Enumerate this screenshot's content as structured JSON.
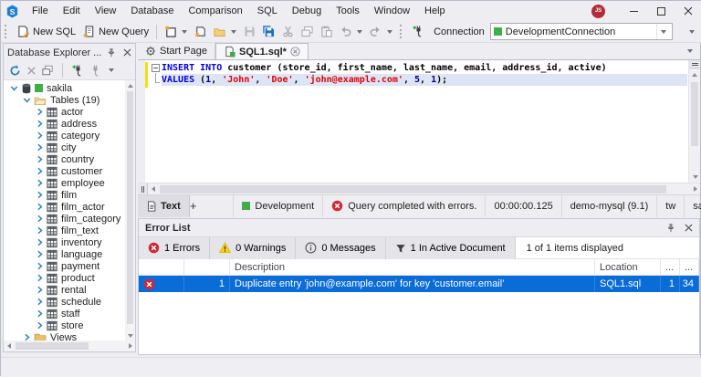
{
  "colors": {
    "accent": "#0a6cd6",
    "chrome": "#eeeef2",
    "env_green": "#3fae49",
    "error_red": "#ce2b37",
    "warning_yellow": "#fbd20b",
    "keyword_blue": "#0000e0",
    "string_red": "#e00000",
    "number_navy": "#000090",
    "modified_line_yellow": "#f2df0e"
  },
  "titlebar": {
    "menu": [
      "File",
      "Edit",
      "View",
      "Database",
      "Comparison",
      "SQL",
      "Debug",
      "Tools",
      "Window",
      "Help"
    ],
    "avatar_initials": "JS"
  },
  "toolbar": {
    "new_sql_label": "New SQL",
    "new_query_label": "New Query",
    "connection_label": "Connection",
    "connection_value": "DevelopmentConnection"
  },
  "explorer": {
    "title": "Database Explorer ...",
    "tree": [
      {
        "label": "sakila",
        "icon": "db",
        "status": "green-sq",
        "chevron": "expanded",
        "level": 0
      },
      {
        "label": "Tables (19)",
        "icon": "folder-open",
        "chevron": "expanded",
        "level": 1
      },
      {
        "label": "actor",
        "icon": "table",
        "chevron": "collapsed",
        "level": 2
      },
      {
        "label": "address",
        "icon": "table",
        "chevron": "collapsed",
        "level": 2
      },
      {
        "label": "category",
        "icon": "table",
        "chevron": "collapsed",
        "level": 2
      },
      {
        "label": "city",
        "icon": "table",
        "chevron": "collapsed",
        "level": 2
      },
      {
        "label": "country",
        "icon": "table",
        "chevron": "collapsed",
        "level": 2
      },
      {
        "label": "customer",
        "icon": "table",
        "chevron": "collapsed",
        "level": 2
      },
      {
        "label": "employee",
        "icon": "table",
        "chevron": "collapsed",
        "level": 2
      },
      {
        "label": "film",
        "icon": "table",
        "chevron": "collapsed",
        "level": 2
      },
      {
        "label": "film_actor",
        "icon": "table",
        "chevron": "collapsed",
        "level": 2
      },
      {
        "label": "film_category",
        "icon": "table",
        "chevron": "collapsed",
        "level": 2
      },
      {
        "label": "film_text",
        "icon": "table",
        "chevron": "collapsed",
        "level": 2
      },
      {
        "label": "inventory",
        "icon": "table",
        "chevron": "collapsed",
        "level": 2
      },
      {
        "label": "language",
        "icon": "table",
        "chevron": "collapsed",
        "level": 2
      },
      {
        "label": "payment",
        "icon": "table",
        "chevron": "collapsed",
        "level": 2
      },
      {
        "label": "product",
        "icon": "table",
        "chevron": "collapsed",
        "level": 2
      },
      {
        "label": "rental",
        "icon": "table",
        "chevron": "collapsed",
        "level": 2
      },
      {
        "label": "schedule",
        "icon": "table",
        "chevron": "collapsed",
        "level": 2
      },
      {
        "label": "staff",
        "icon": "table",
        "chevron": "collapsed",
        "level": 2
      },
      {
        "label": "store",
        "icon": "table",
        "chevron": "collapsed",
        "level": 2
      },
      {
        "label": "Views",
        "icon": "folder-closed",
        "chevron": "collapsed",
        "level": 1
      }
    ]
  },
  "tabs": [
    {
      "label": "Start Page",
      "icon": "gear",
      "active": false
    },
    {
      "label": "SQL1.sql*",
      "icon": "sql-doc",
      "active": true
    }
  ],
  "editor": {
    "lines": [
      {
        "highlight": false,
        "tokens": [
          {
            "t": "INSERT INTO",
            "c": "kw"
          },
          {
            "t": " customer (store_id, first_name, last_name, email, address_id, active)",
            "c": "pl"
          }
        ]
      },
      {
        "highlight": true,
        "tokens": [
          {
            "t": "VALUES",
            "c": "kw"
          },
          {
            "t": " (",
            "c": "pl"
          },
          {
            "t": "1",
            "c": "num"
          },
          {
            "t": ", ",
            "c": "pl"
          },
          {
            "t": "'John'",
            "c": "str"
          },
          {
            "t": ", ",
            "c": "pl"
          },
          {
            "t": "'Doe'",
            "c": "str"
          },
          {
            "t": ", ",
            "c": "pl"
          },
          {
            "t": "'john@example.com'",
            "c": "str"
          },
          {
            "t": ", ",
            "c": "pl"
          },
          {
            "t": "5",
            "c": "num"
          },
          {
            "t": ", ",
            "c": "pl"
          },
          {
            "t": "1",
            "c": "num"
          },
          {
            "t": ");",
            "c": "pl"
          }
        ]
      }
    ]
  },
  "doc_statusbar": {
    "view_tab": "Text",
    "add_tab": "+",
    "segments": [
      {
        "name": "environment",
        "icon": "green-sq",
        "label": "Development"
      },
      {
        "name": "query-status",
        "icon": "error",
        "label": "Query completed with errors."
      },
      {
        "name": "execution-time",
        "icon": "",
        "label": "00:00:00.125"
      },
      {
        "name": "server",
        "icon": "",
        "label": "demo-mysql (9.1)"
      },
      {
        "name": "user",
        "icon": "",
        "label": "tw"
      },
      {
        "name": "database",
        "icon": "",
        "label": "sakila"
      }
    ]
  },
  "error_list": {
    "title": "Error List",
    "filters": {
      "errors": "1 Errors",
      "warnings": "0 Warnings",
      "messages": "0 Messages",
      "active_document": "1 In Active Document",
      "summary": "1 of 1 items displayed"
    },
    "columns": {
      "description": "Description",
      "location": "Location",
      "line": "...",
      "column": "..."
    },
    "rows": [
      {
        "severity": "error",
        "num": "1",
        "description": "Duplicate entry 'john@example.com' for key 'customer.email'",
        "location": "SQL1.sql",
        "line": "1",
        "column": "34"
      }
    ]
  }
}
